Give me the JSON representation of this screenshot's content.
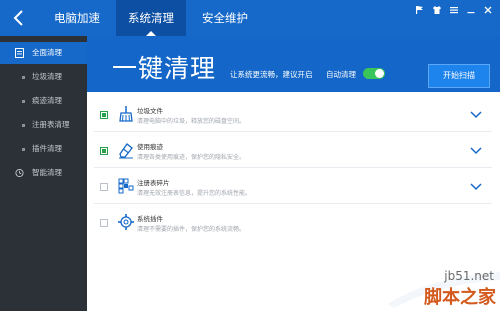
{
  "tabs": [
    {
      "label": "电脑加速",
      "active": false
    },
    {
      "label": "系统清理",
      "active": true
    },
    {
      "label": "安全维护",
      "active": false
    }
  ],
  "window_controls": [
    "flag-icon",
    "shirt-icon",
    "menu-icon",
    "minimize-icon",
    "close-icon"
  ],
  "sidebar": {
    "items": [
      {
        "label": "全面清理",
        "active": true,
        "icon": "doc-icon"
      },
      {
        "label": "垃圾清理",
        "active": false
      },
      {
        "label": "痕迹清理",
        "active": false
      },
      {
        "label": "注册表清理",
        "active": false
      },
      {
        "label": "插件清理",
        "active": false
      },
      {
        "label": "智能清理",
        "active": false,
        "icon": "clock-icon"
      }
    ]
  },
  "hero": {
    "title": "一键清理",
    "subtitle": "让系统更流畅，建议开启",
    "auto_label": "自动清理",
    "auto_enabled": true,
    "scan_button": "开始扫描"
  },
  "rows": [
    {
      "title": "垃圾文件",
      "desc": "清理电脑中的垃圾，释放您的磁盘空间。",
      "checked": true,
      "icon": "broom-icon"
    },
    {
      "title": "使用痕迹",
      "desc": "清理各类使用痕迹，保护您的隐私安全。",
      "checked": true,
      "icon": "eraser-icon"
    },
    {
      "title": "注册表碎片",
      "desc": "清理无效注册表信息，提升您的系统性能。",
      "checked": false,
      "icon": "registry-icon"
    },
    {
      "title": "系统插件",
      "desc": "清理不需要的插件，保护您的系统流畅。",
      "checked": false,
      "icon": "plugin-gear-icon"
    }
  ],
  "watermark": {
    "top": "jb51.net",
    "bottom": "脚本之家"
  },
  "colors": {
    "accent": "#1669c9",
    "sidebar": "#2c3138",
    "toggle_on": "#39c55a",
    "watermark": "#d35a1c"
  }
}
